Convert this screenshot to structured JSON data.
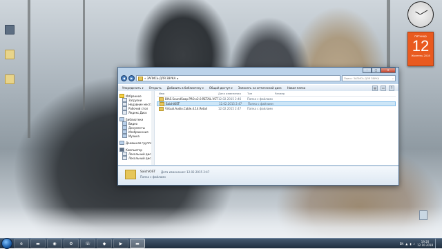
{
  "desktop": {
    "icons": [
      {
        "label": ""
      },
      {
        "label": ""
      },
      {
        "label": ""
      }
    ],
    "recycle_label": ""
  },
  "gadgets": {
    "calendar": {
      "top": "пятница",
      "day": "12",
      "bottom": "Жовтень 2018"
    }
  },
  "window": {
    "address": [
      "« ЗАПИСЬ ДЛЯ ЗВУКА",
      "▸"
    ],
    "search_placeholder": "Поиск: ЗАПИСЬ ДЛЯ ЗВУКА",
    "toolbar": [
      "Упорядочить ▾",
      "Открыть",
      "Добавить в библиотеку ▾",
      "Общий доступ ▾",
      "Записать на оптический диск",
      "Новая папка"
    ],
    "nav": {
      "favorites": {
        "title": "Избранное",
        "items": [
          "Загрузки",
          "Недавние места",
          "Рабочий стол",
          "Яндекс.Диск"
        ]
      },
      "libraries": {
        "title": "Библиотеки",
        "items": [
          "Видео",
          "Документы",
          "Изображения",
          "Музыка"
        ]
      },
      "homegroup": "Домашняя группа",
      "computer": {
        "title": "Компьютер",
        "items": [
          "Локальный диск",
          "Локальный диск"
        ]
      }
    },
    "columns": [
      "Имя",
      "Дата изменения",
      "Тип",
      "Размер"
    ],
    "rows": [
      {
        "name": "BIAS.SoundSoap.PRO.v2.0.RETAiL.VST",
        "date": "12.02.2015 2:46",
        "type": "Папка с файлами",
        "size": ""
      },
      {
        "name": "SaichiOST",
        "date": "12.02.2015 2:47",
        "type": "Папка с файлами",
        "size": ""
      },
      {
        "name": "Virtual.Audio.Cable.4.14.Retail",
        "date": "12.02.2015 2:47",
        "type": "Папка с файлами",
        "size": ""
      }
    ],
    "selected_row": 1,
    "details": {
      "name": "SaichiOST",
      "type": "Папка с файлами",
      "modified": "Дата изменения: 12.02.2015 2:47"
    }
  },
  "taskbar": {
    "lang": "EN",
    "time": "19:20",
    "date": "12.10.2018"
  }
}
